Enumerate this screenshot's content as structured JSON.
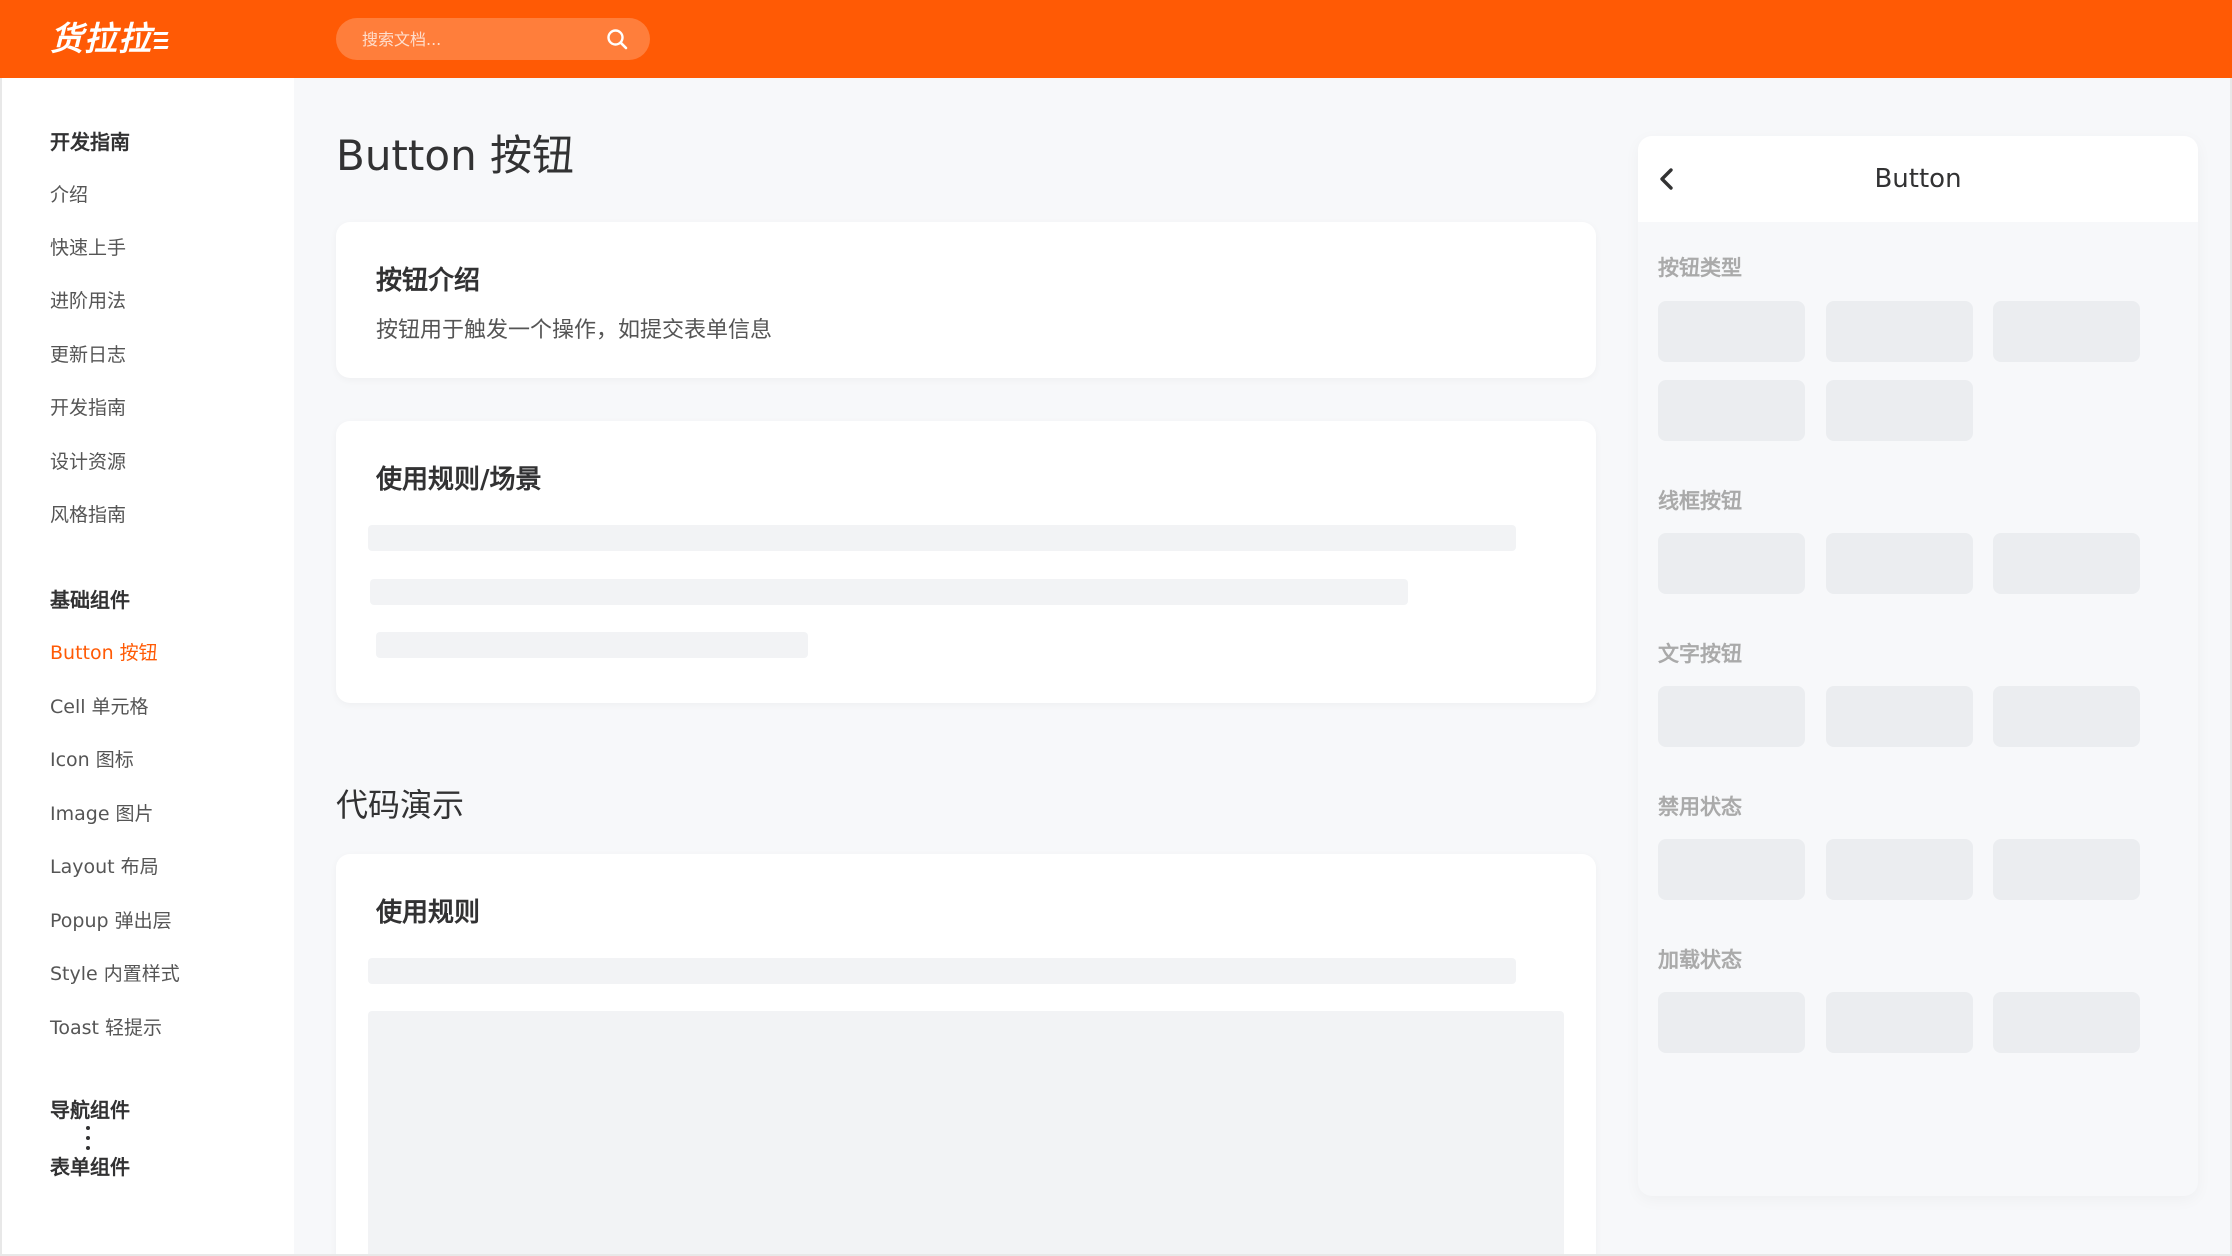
{
  "header": {
    "logo_text": "货拉拉",
    "search_placeholder": "搜索文档..."
  },
  "sidebar": {
    "groups": [
      {
        "label": "开发指南"
      },
      {
        "label": "基础组件"
      },
      {
        "label": "导航组件"
      },
      {
        "label": "表单组件"
      }
    ],
    "items": [
      {
        "label": "介绍"
      },
      {
        "label": "快速上手"
      },
      {
        "label": "进阶用法"
      },
      {
        "label": "更新日志"
      },
      {
        "label": "开发指南"
      },
      {
        "label": "设计资源"
      },
      {
        "label": "风格指南"
      },
      {
        "label": "Button 按钮",
        "active": true
      },
      {
        "label": "Cell 单元格"
      },
      {
        "label": "Icon 图标"
      },
      {
        "label": "Image 图片"
      },
      {
        "label": "Layout 布局"
      },
      {
        "label": "Popup 弹出层"
      },
      {
        "label": "Style 内置样式"
      },
      {
        "label": "Toast 轻提示"
      }
    ]
  },
  "main": {
    "title": "Button 按钮",
    "intro_card": {
      "title": "按钮介绍",
      "text": "按钮用于触发一个操作，如提交表单信息"
    },
    "rules_card": {
      "title": "使用规则/场景"
    },
    "demo_section_title": "代码演示",
    "demo_card": {
      "title": "使用规则"
    }
  },
  "preview": {
    "nav_title": "Button",
    "sections": [
      {
        "label": "按钮类型"
      },
      {
        "label": "线框按钮"
      },
      {
        "label": "文字按钮"
      },
      {
        "label": "禁用状态"
      },
      {
        "label": "加载状态"
      }
    ]
  },
  "colors": {
    "brand": "#ff5a05",
    "background": "#f7f8fa",
    "skeleton": "#f2f3f5",
    "placeholder_button": "#ebedf0"
  }
}
